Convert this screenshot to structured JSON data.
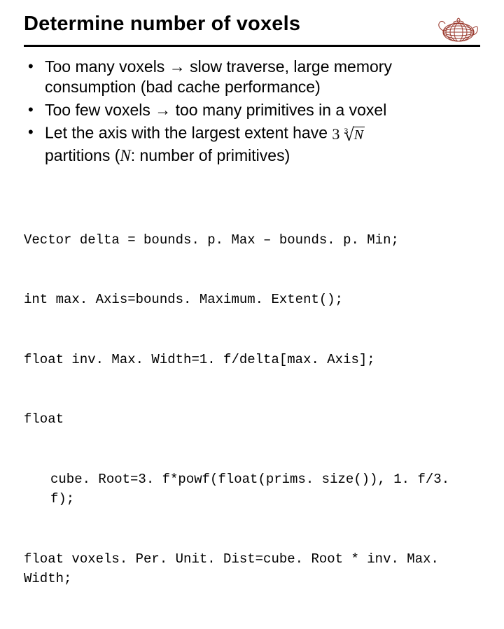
{
  "title": "Determine number of voxels",
  "bullets": {
    "b1": "Too many voxels → slow traverse, large memory consumption (bad cache performance)",
    "b2": "Too few voxels → too many primitives in a voxel",
    "b3_prefix": "Let the axis with the largest extent have ",
    "b3_suffix_a": "partitions (",
    "b3_suffix_b": ": number of primitives)"
  },
  "formula": {
    "coef": "3",
    "root_index": "3",
    "radicand": "N",
    "N_symbol": "N"
  },
  "code": {
    "l1": "Vector delta = bounds. p. Max – bounds. p. Min;",
    "l2": "int max. Axis=bounds. Maximum. Extent();",
    "l3": "float inv. Max. Width=1. f/delta[max. Axis];",
    "l4a": "float",
    "l4b": "cube. Root=3. f*powf(float(prims. size()), 1. f/3. f);",
    "l5": "float voxels. Per. Unit. Dist=cube. Root * inv. Max. Width;"
  },
  "logo_name": "teapot-wireframe-icon"
}
